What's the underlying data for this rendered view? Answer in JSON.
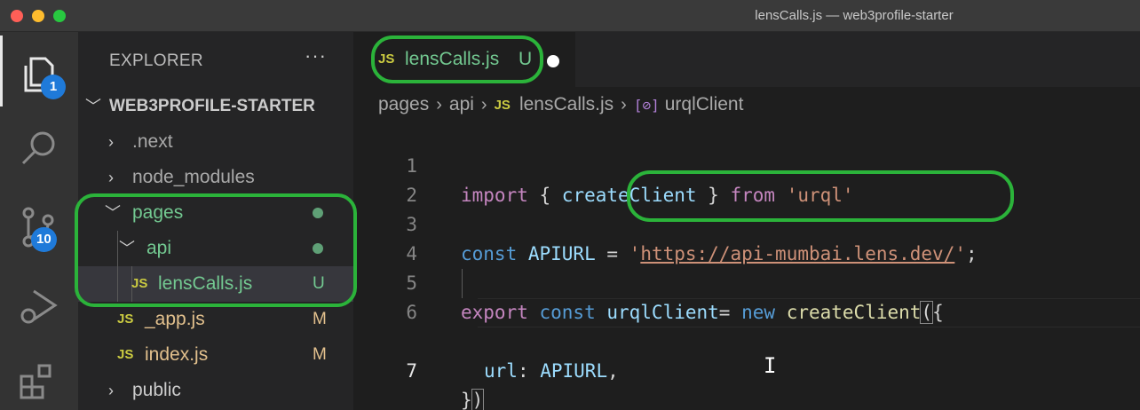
{
  "window": {
    "title": "lensCalls.js — web3profile-starter"
  },
  "activity_bar": {
    "explorer_badge": "1",
    "scm_badge": "10"
  },
  "sidebar": {
    "header": "EXPLORER",
    "more": "···",
    "project": "WEB3PROFILE-STARTER",
    "items": [
      {
        "label": ".next",
        "type": "folder",
        "expanded": false
      },
      {
        "label": "node_modules",
        "type": "folder",
        "expanded": false
      },
      {
        "label": "pages",
        "type": "folder",
        "expanded": true,
        "status": "dot"
      },
      {
        "label": "api",
        "type": "folder",
        "expanded": true,
        "status": "dot"
      },
      {
        "label": "lensCalls.js",
        "type": "file",
        "icon": "JS",
        "status": "U"
      },
      {
        "label": "_app.js",
        "type": "file",
        "icon": "JS",
        "status": "M"
      },
      {
        "label": "index.js",
        "type": "file",
        "icon": "JS",
        "status": "M"
      },
      {
        "label": "public",
        "type": "folder",
        "expanded": false
      }
    ]
  },
  "editor": {
    "tab": {
      "icon": "JS",
      "label": "lensCalls.js",
      "status": "U"
    },
    "breadcrumb": {
      "parts": [
        "pages",
        "api",
        "lensCalls.js",
        "urqlClient"
      ],
      "file_icon": "JS",
      "symbol_icon": "[⊘]"
    },
    "lines": [
      {
        "n": "1"
      },
      {
        "n": "2"
      },
      {
        "n": "3"
      },
      {
        "n": "4"
      },
      {
        "n": "5"
      },
      {
        "n": "6"
      },
      {
        "n": "7"
      }
    ],
    "tokens": {
      "l1_import": "import",
      "l1_open": " { ",
      "l1_name": "createClient",
      "l1_close": " } ",
      "l1_from": "from",
      "l1_space": " ",
      "l1_str": "'urql'",
      "l3_const": "const",
      "l3_var": " APIURL",
      "l3_eq": " = ",
      "l3_q1": "'",
      "l3_url": "https://api-mumbai.lens.dev/",
      "l3_q2": "'",
      "l3_semi": ";",
      "l5_export": "export",
      "l5_const": " const",
      "l5_var": " urqlClient",
      "l5_eq": "= ",
      "l5_new": "new",
      "l5_sp": " ",
      "l5_fn": "createClient",
      "l5_paren": "(",
      "l5_brace": "{",
      "l6_prop": "url",
      "l6_colon": ": ",
      "l6_val": "APIURL",
      "l6_comma": ",",
      "l7_brace": "}",
      "l7_paren": ")"
    }
  },
  "colors": {
    "annotation": "#2bb33a",
    "git_untracked": "#73c991",
    "git_modified": "#e2c08d",
    "js_icon": "#cbcb41"
  }
}
